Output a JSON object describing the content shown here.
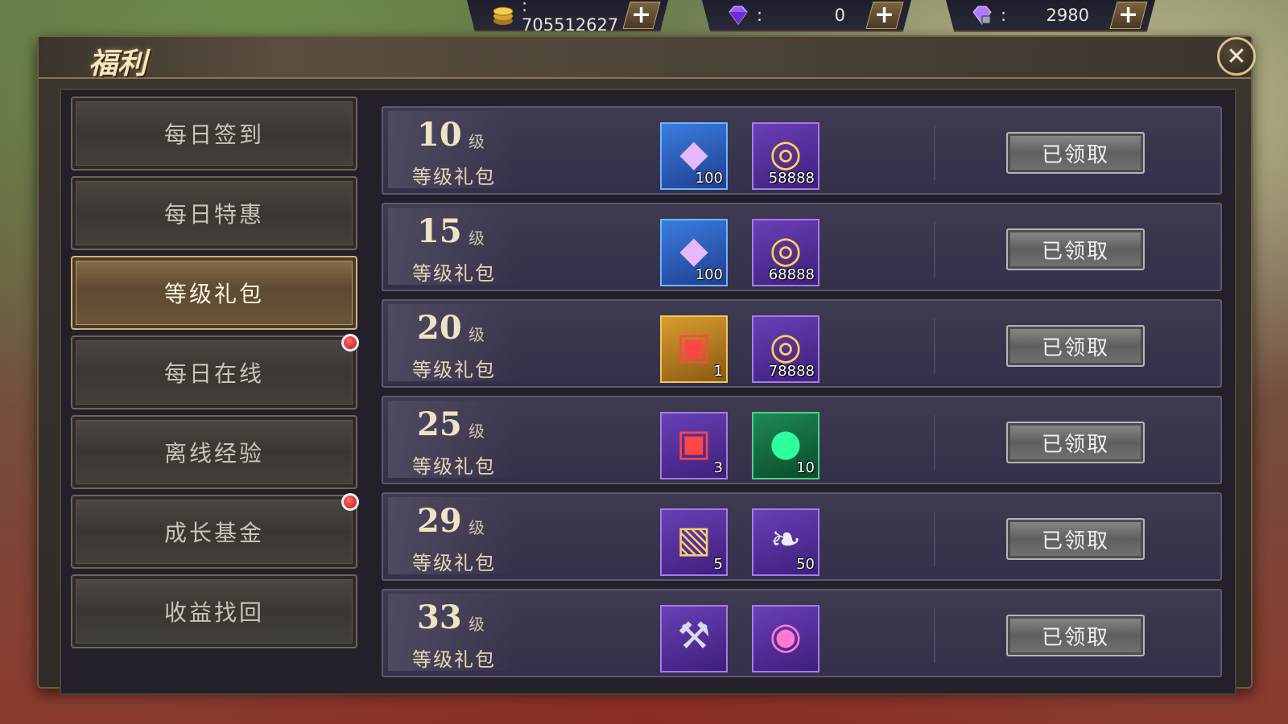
{
  "resources": {
    "gold": {
      "icon": "gold-coin-icon",
      "value": ": 705512627"
    },
    "gem": {
      "icon": "purple-diamond-icon",
      "value": "0"
    },
    "bound_gem": {
      "icon": "locked-diamond-icon",
      "value": "2980"
    },
    "plus_label": "+",
    "colon": ":"
  },
  "panel": {
    "title": "福利",
    "close_label": "✕"
  },
  "menu": {
    "items": [
      {
        "label": "每日签到",
        "active": false,
        "badge": false
      },
      {
        "label": "每日特惠",
        "active": false,
        "badge": false
      },
      {
        "label": "等级礼包",
        "active": true,
        "badge": false
      },
      {
        "label": "每日在线",
        "active": false,
        "badge": true
      },
      {
        "label": "离线经验",
        "active": false,
        "badge": false
      },
      {
        "label": "成长基金",
        "active": false,
        "badge": true
      },
      {
        "label": "收益找回",
        "active": false,
        "badge": false
      }
    ]
  },
  "rewards": [
    {
      "level": "10",
      "unit": "级",
      "label": "等级礼包",
      "button": "已领取",
      "items": [
        {
          "icon": "purple-crystal-icon",
          "qty": "100"
        },
        {
          "icon": "coin-stack-icon",
          "qty": "58888"
        }
      ]
    },
    {
      "level": "15",
      "unit": "级",
      "label": "等级礼包",
      "button": "已领取",
      "items": [
        {
          "icon": "purple-crystal-icon",
          "qty": "100"
        },
        {
          "icon": "coin-stack-icon",
          "qty": "68888"
        }
      ]
    },
    {
      "level": "20",
      "unit": "级",
      "label": "等级礼包",
      "button": "已领取",
      "items": [
        {
          "icon": "golden-gift-box-icon",
          "qty": "1"
        },
        {
          "icon": "coin-stack-icon",
          "qty": "78888"
        }
      ]
    },
    {
      "level": "25",
      "unit": "级",
      "label": "等级礼包",
      "button": "已领取",
      "items": [
        {
          "icon": "purple-gift-box-icon",
          "qty": "3"
        },
        {
          "icon": "green-orb-icon",
          "qty": "10"
        }
      ]
    },
    {
      "level": "29",
      "unit": "级",
      "label": "等级礼包",
      "button": "已领取",
      "items": [
        {
          "icon": "treasure-map-icon",
          "qty": "5"
        },
        {
          "icon": "feather-icon",
          "qty": "50"
        }
      ]
    },
    {
      "level": "33",
      "unit": "级",
      "label": "等级礼包",
      "button": "已领取",
      "items": [
        {
          "icon": "hammer-icon",
          "qty": ""
        },
        {
          "icon": "pink-gem-icon",
          "qty": ""
        }
      ]
    }
  ]
}
